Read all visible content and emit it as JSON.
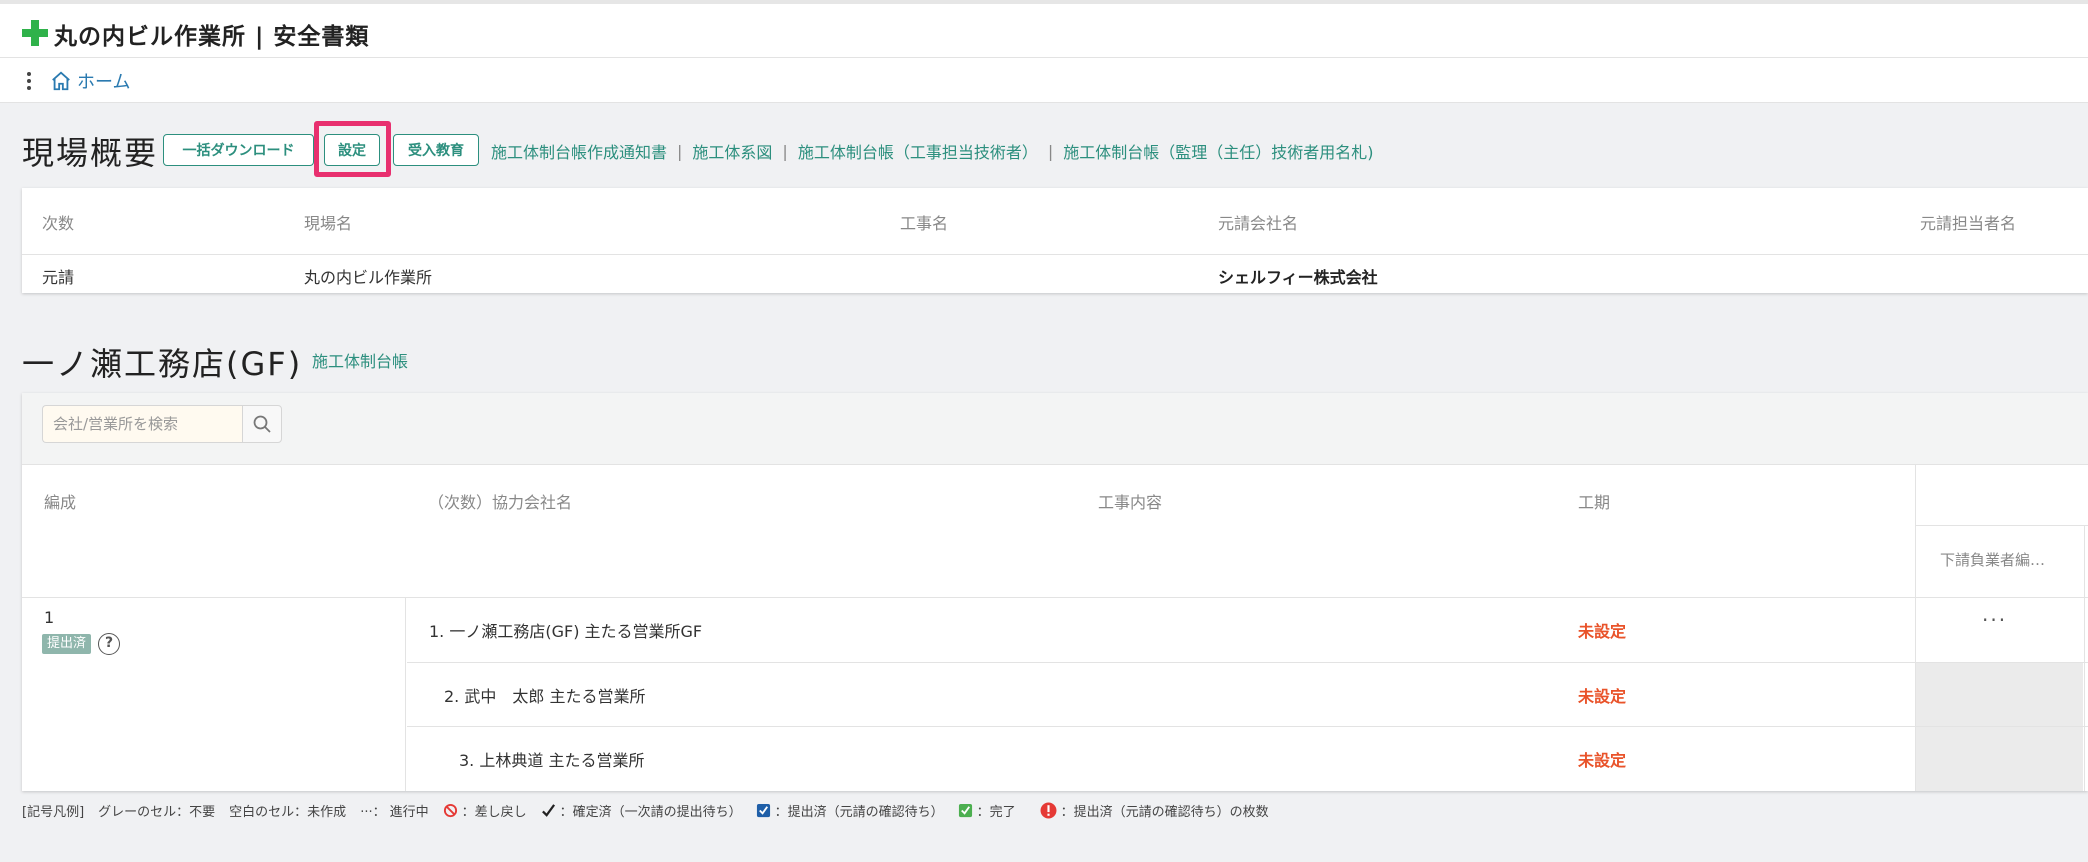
{
  "app": {
    "title": "丸の内ビル作業所 | 安全書類"
  },
  "nav": {
    "home_label": "ホーム"
  },
  "overview": {
    "title": "現場概要",
    "buttons": {
      "bulk_download": "一括ダウンロード",
      "settings": "設定",
      "entry_education": "受入教育"
    },
    "doc_links": [
      "施工体制台帳作成通知書",
      "施工体系図",
      "施工体制台帳（工事担当技術者）",
      "施工体制台帳（監理（主任）技術者用名札)"
    ],
    "separator": "|",
    "table": {
      "headers": [
        "次数",
        "現場名",
        "工事名",
        "元請会社名",
        "元請担当者名"
      ],
      "row": [
        "元請",
        "丸の内ビル作業所",
        "",
        "シェルフィー株式会社",
        ""
      ]
    }
  },
  "subcontractor": {
    "title": "一ノ瀬工務店(GF)",
    "ledger_link": "施工体制台帳",
    "search_placeholder": "会社/営業所を検索",
    "headers": {
      "formation": "編成",
      "company": "（次数）協力会社名",
      "work": "工事内容",
      "period": "工期",
      "sub_register": "下請負業者編…"
    },
    "group": {
      "number": "1",
      "status": "提出済",
      "help": "?"
    },
    "rows": [
      {
        "company": "1. 一ノ瀬工務店(GF) 主たる営業所GF",
        "period": "未設定"
      },
      {
        "company": "2. 武中　太郎 主たる営業所",
        "period": "未設定"
      },
      {
        "company": "3. 上林典道 主たる営業所",
        "period": "未設定"
      }
    ],
    "more": "···"
  },
  "legend": {
    "title": "[記号凡例]",
    "grey_cell": "グレーのセル：不要",
    "blank_cell": "空白のセル：未作成",
    "in_progress_symbol": "···：",
    "in_progress": "進行中",
    "returned": "：差し戻し",
    "confirmed": "：確定済（一次請の提出待ち）",
    "submitted": "：提出済（元請の確認待ち）",
    "done": "：完了",
    "count": "：提出済（元請の確認待ち）の枚数"
  },
  "colors": {
    "accent": "#2c8f7e",
    "link": "#2a7ab0",
    "highlight": "#e8306f",
    "unset": "#e9532a",
    "badge": "#8fb6ac"
  }
}
